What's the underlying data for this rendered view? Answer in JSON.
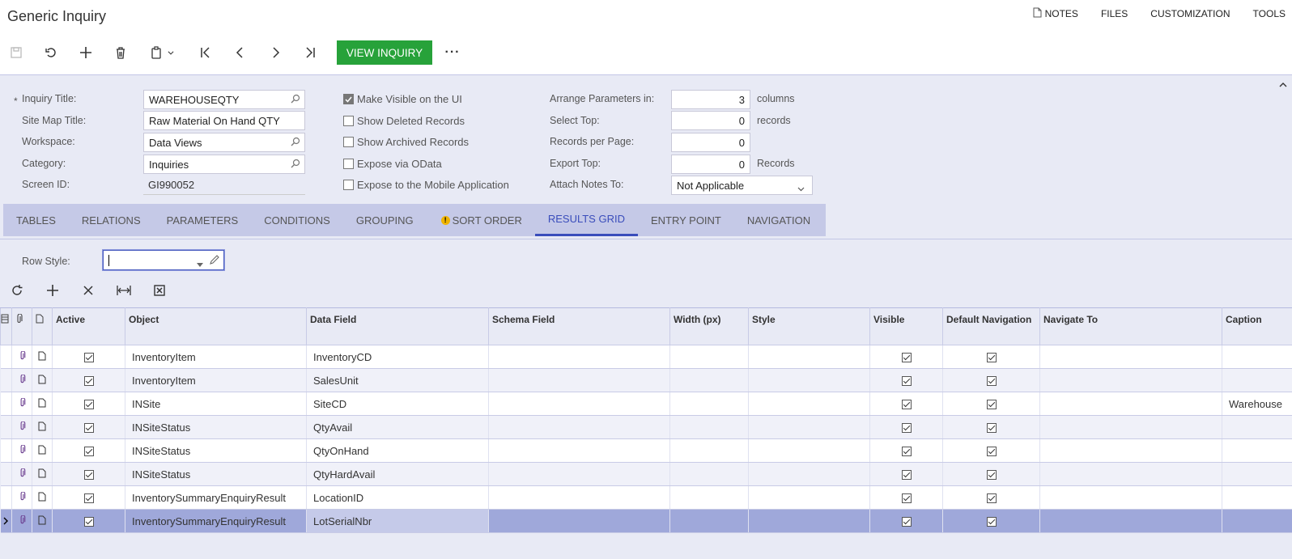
{
  "header": {
    "title": "Generic Inquiry",
    "links": {
      "notes": "NOTES",
      "files": "FILES",
      "customization": "CUSTOMIZATION",
      "tools": "TOOLS"
    }
  },
  "toolbar": {
    "view_inquiry": "VIEW INQUIRY",
    "more": "···"
  },
  "form": {
    "required_mark": "*",
    "inquiry_title": {
      "label": "Inquiry Title:",
      "value": "WAREHOUSEQTY"
    },
    "site_map_title": {
      "label": "Site Map Title:",
      "value": "Raw Material On Hand QTY"
    },
    "workspace": {
      "label": "Workspace:",
      "value": "Data Views"
    },
    "category": {
      "label": "Category:",
      "value": "Inquiries"
    },
    "screen_id": {
      "label": "Screen ID:",
      "value": "GI990052"
    },
    "checkboxes": {
      "make_visible": {
        "label": "Make Visible on the UI",
        "checked": true
      },
      "show_deleted": {
        "label": "Show Deleted Records",
        "checked": false
      },
      "show_archived": {
        "label": "Show Archived Records",
        "checked": false
      },
      "expose_odata": {
        "label": "Expose via OData",
        "checked": false
      },
      "expose_mobile": {
        "label": "Expose to the Mobile Application",
        "checked": false
      }
    },
    "arrange_params": {
      "label": "Arrange Parameters in:",
      "value": "3",
      "unit": "columns"
    },
    "select_top": {
      "label": "Select Top:",
      "value": "0",
      "unit": "records"
    },
    "records_per_page": {
      "label": "Records per Page:",
      "value": "0"
    },
    "export_top": {
      "label": "Export Top:",
      "value": "0",
      "unit": "Records"
    },
    "attach_notes": {
      "label": "Attach Notes To:",
      "value": "Not Applicable"
    }
  },
  "tabs": [
    "TABLES",
    "RELATIONS",
    "PARAMETERS",
    "CONDITIONS",
    "GROUPING",
    "SORT ORDER",
    "RESULTS GRID",
    "ENTRY POINT",
    "NAVIGATION"
  ],
  "active_tab": "RESULTS GRID",
  "results": {
    "row_style_label": "Row Style:",
    "columns": {
      "active": "Active",
      "object": "Object",
      "data_field": "Data Field",
      "schema_field": "Schema Field",
      "width": "Width (px)",
      "style": "Style",
      "visible": "Visible",
      "default_nav": "Default Navigation",
      "navigate_to": "Navigate To",
      "caption": "Caption"
    },
    "rows": [
      {
        "object": "InventoryItem",
        "data_field": "InventoryCD",
        "caption": ""
      },
      {
        "object": "InventoryItem",
        "data_field": "SalesUnit",
        "caption": ""
      },
      {
        "object": "INSite",
        "data_field": "SiteCD",
        "caption": "Warehouse"
      },
      {
        "object": "INSiteStatus",
        "data_field": "QtyAvail",
        "caption": ""
      },
      {
        "object": "INSiteStatus",
        "data_field": "QtyOnHand",
        "caption": ""
      },
      {
        "object": "INSiteStatus",
        "data_field": "QtyHardAvail",
        "caption": ""
      },
      {
        "object": "InventorySummaryEnquiryResult",
        "data_field": "LocationID",
        "caption": ""
      },
      {
        "object": "InventorySummaryEnquiryResult",
        "data_field": "LotSerialNbr",
        "caption": ""
      }
    ],
    "selected_row": 7
  },
  "icons": {
    "save": "save-icon",
    "undo": "undo-icon",
    "add": "plus-icon",
    "delete": "trash-icon",
    "copy": "copy-icon",
    "first": "first-icon",
    "prev": "prev-icon",
    "next": "next-icon",
    "last": "last-icon",
    "refresh": "refresh-icon",
    "remove": "close-icon",
    "fit": "fit-columns-icon",
    "excel": "excel-icon"
  },
  "colors": {
    "accent": "#3a4dbb",
    "primary_button": "#27a23a",
    "form_bg": "#e8eaf5",
    "tab_bg": "#c5c9e7",
    "selected_row": "#9fa8da"
  }
}
